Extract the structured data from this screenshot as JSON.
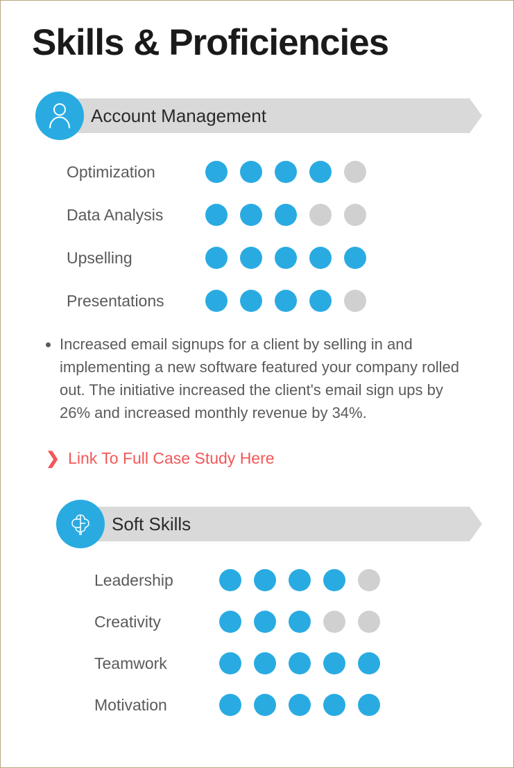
{
  "title": "Skills & Proficiencies",
  "colors": {
    "accent": "#29abe2",
    "link": "#f25757",
    "dot_off": "#d0d0d0"
  },
  "sections": [
    {
      "icon": "user-icon",
      "title": "Account Management",
      "skills": [
        {
          "label": "Optimization",
          "rating": 4,
          "max": 5
        },
        {
          "label": "Data Analysis",
          "rating": 3,
          "max": 5
        },
        {
          "label": "Upselling",
          "rating": 5,
          "max": 5
        },
        {
          "label": "Presentations",
          "rating": 4,
          "max": 5
        }
      ]
    },
    {
      "icon": "brain-icon",
      "title": "Soft Skills",
      "skills": [
        {
          "label": "Leadership",
          "rating": 4,
          "max": 5
        },
        {
          "label": "Creativity",
          "rating": 3,
          "max": 5
        },
        {
          "label": "Teamwork",
          "rating": 5,
          "max": 5
        },
        {
          "label": "Motivation",
          "rating": 5,
          "max": 5
        }
      ]
    }
  ],
  "bullet": "Increased email signups for a client by selling in and implementing a new software featured your company rolled out. The initiative increased the client's email sign ups by 26% and increased monthly revenue by 34%.",
  "link_text": "Link To Full Case Study Here"
}
